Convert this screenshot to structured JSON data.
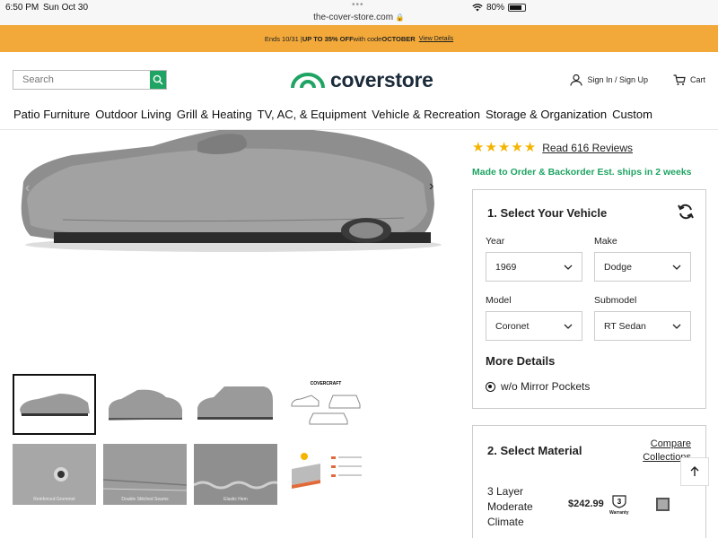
{
  "status_bar": {
    "time": "6:50 PM",
    "date": "Sun Oct 30",
    "url": "the-cover-store.com",
    "battery": "80%",
    "battery_level": 0.8
  },
  "promo": {
    "prefix": "Ends 10/31 | ",
    "highlight": "UP TO 35% OFF",
    "middle": " with code ",
    "code": "OCTOBER",
    "link": "View Details",
    "background": "#f2a93a"
  },
  "header": {
    "search_placeholder": "Search",
    "logo_text": "coverstore",
    "sign_in": "Sign In / Sign Up",
    "cart": "Cart",
    "brand_green": "#1fa463"
  },
  "nav": {
    "items": [
      "Patio Furniture",
      "Outdoor Living",
      "Grill & Heating",
      "TV, AC, & Equipment",
      "Vehicle & Recreation",
      "Storage & Organization",
      "Custom"
    ]
  },
  "gallery": {
    "thumb_labels": [
      "Reinforced Grommet",
      "Double Stitched Seams",
      "Elastic Hem"
    ],
    "brand_label": "COVERCRAFT"
  },
  "product": {
    "rating": 5,
    "reviews_link": "Read 616 Reviews",
    "ships": "Made to Order & Backorder Est. ships in 2 weeks"
  },
  "vehicle": {
    "title": "1. Select Your Vehicle",
    "year_label": "Year",
    "year_value": "1969",
    "make_label": "Make",
    "make_value": "Dodge",
    "model_label": "Model",
    "model_value": "Coronet",
    "submodel_label": "Submodel",
    "submodel_value": "RT Sedan",
    "more_details": "More Details",
    "option": "w/o Mirror Pockets"
  },
  "material": {
    "title": "2. Select Material",
    "compare_line1": "Compare",
    "compare_line2": "Collections",
    "name_line1": "3 Layer",
    "name_line2": "Moderate",
    "name_line3": "Climate",
    "price": "$242.99",
    "warranty_num": "3",
    "warranty_label": "Warranty"
  }
}
